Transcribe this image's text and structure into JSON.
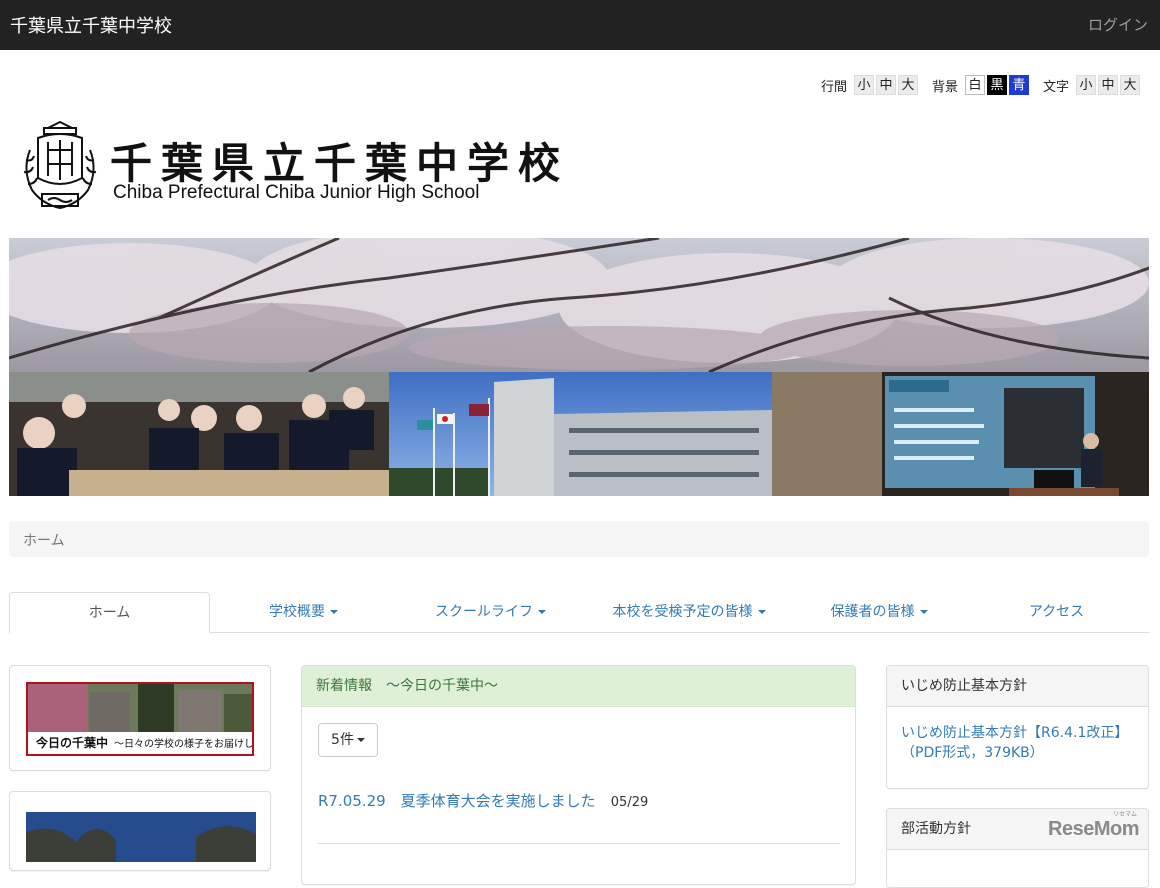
{
  "navbar": {
    "brand": "千葉県立千葉中学校",
    "login": "ログイン"
  },
  "accessibility": {
    "line_spacing_label": "行間",
    "line_spacing_options": [
      "小",
      "中",
      "大"
    ],
    "background_label": "背景",
    "background_options": [
      "白",
      "黒",
      "青"
    ],
    "text_size_label": "文字",
    "text_size_options": [
      "小",
      "中",
      "大"
    ]
  },
  "logo": {
    "title": "千葉県立千葉中学校",
    "subtitle": "Chiba Prefectural Chiba Junior High School"
  },
  "breadcrumb": "ホーム",
  "tabs": [
    "ホーム",
    "学校概要",
    "スクールライフ",
    "本校を受検予定の皆様",
    "保護者の皆様",
    "アクセス"
  ],
  "left_banner": {
    "title": "今日の千葉中",
    "subtitle": "～日々の学校の様子をお届けします～"
  },
  "news": {
    "heading": "新着情報　～今日の千葉中～",
    "count_button": "5件",
    "items": [
      {
        "title": "R7.05.29　夏季体育大会を実施しました",
        "date": "05/29"
      }
    ]
  },
  "sidebar_right": {
    "panel1_heading": "いじめ防止基本方針",
    "panel1_link": "いじめ防止基本方針【R6.4.1改正】（PDF形式，379KB）",
    "panel2_heading": "部活動方針"
  },
  "watermark": {
    "text": "ReseMom",
    "small": "リセマム"
  },
  "colors": {
    "navbar": "#222222",
    "link": "#337ab7",
    "news_heading_bg": "#dff0d8",
    "news_heading_text": "#3c763d",
    "banner_border": "#b1121b"
  }
}
